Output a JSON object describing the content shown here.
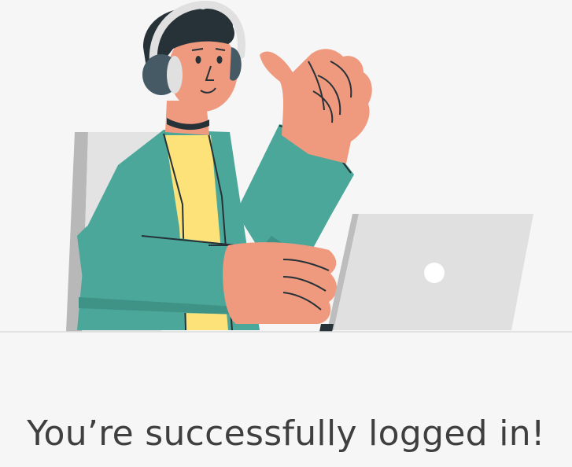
{
  "success": {
    "message": "You’re successfully logged in!"
  },
  "illustration": {
    "icon": "person-thumbs-up-laptop-illustration",
    "colors": {
      "background": "#f6f6f6",
      "jacket": "#4ba79a",
      "jacket_shadow": "#3f9286",
      "shirt": "#fde27a",
      "skin": "#ef9a7e",
      "hair": "#263238",
      "headphones": "#455a64",
      "headphone_band": "#e0e0e0",
      "laptop": "#e0e0e0",
      "laptop_edge": "#bdbdbd",
      "chair": "#e3e3e3",
      "chair_edge": "#b8b8b8",
      "desk_line": "#dcdcdc",
      "message_text": "#3f3f3f"
    }
  }
}
